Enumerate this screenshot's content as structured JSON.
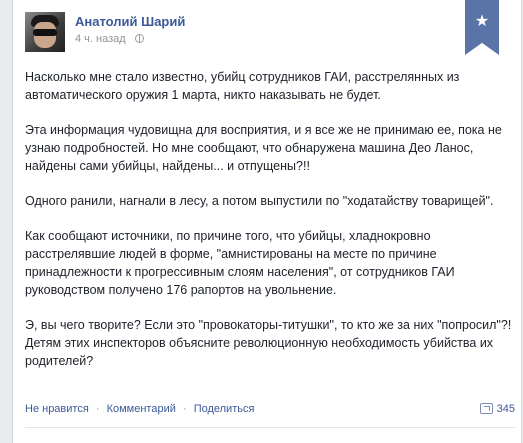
{
  "post": {
    "author": "Анатолий Шарий",
    "time": "4 ч. назад",
    "paragraphs": [
      "Насколько мне стало известно, убийц сотрудников ГАИ, расстрелянных из автоматического оружия 1 марта, никто наказывать не будет.",
      "Эта информация чудовищна для восприятия, и я все же не принимаю ее, пока не узнаю подробностей. Но мне сообщают, что обнаружена машина Део Ланос, найдены сами убийцы, найдены... и отпущены?!!",
      "Одного ранили, нагнали в лесу, а потом выпустили по \"ходатайству товарищей\".",
      "Как сообщают источники, по причине того, что убийцы, хладнокровно расстрелявшие людей в форме, \"амнистированы на месте по причине принадлежности к прогрессивным слоям населения\", от сотрудников ГАИ руководством получено 176 рапортов на увольнение.",
      "Э, вы чего творите? Если это \"провокаторы-титушки\", то кто же за них \"попросил\"?! Детям этих инспекторов объясните революционную необходимость убийства их родителей?"
    ]
  },
  "actions": {
    "unlike": "Не нравится",
    "comment": "Комментарий",
    "share": "Поделиться",
    "separator": "·",
    "share_count": "345"
  },
  "ribbon": {
    "icon": "star-icon",
    "glyph": "★",
    "color": "#5b74a8"
  }
}
